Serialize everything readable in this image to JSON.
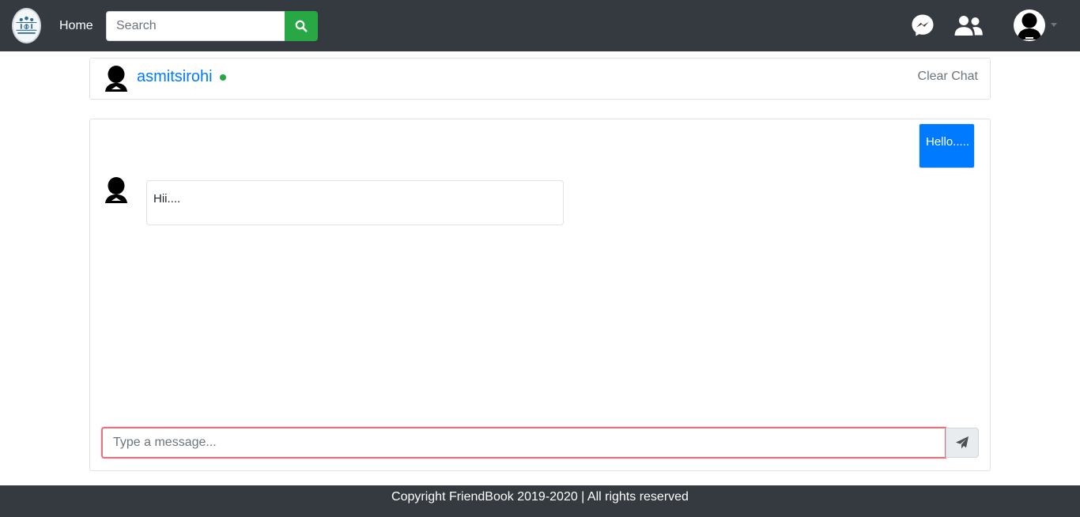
{
  "navbar": {
    "logo_icon": "friendbook-logo-icon",
    "home_label": "Home",
    "search_placeholder": "Search",
    "search_icon": "search-icon",
    "messenger_icon": "messenger-icon",
    "friends_icon": "friends-icon",
    "profile_icon": "user-avatar-icon",
    "search_button_color": "#28a745",
    "background_color": "#343a40"
  },
  "chat_header": {
    "contact_name": "asmitsirohi",
    "status": "online",
    "status_color": "#28a745",
    "clear_label": "Clear Chat"
  },
  "messages": [
    {
      "direction": "outgoing",
      "text": "Hello.....",
      "color": "#007bff"
    },
    {
      "direction": "incoming",
      "text": "Hii...."
    }
  ],
  "composer": {
    "placeholder": "Type a message...",
    "send_icon": "paper-plane-icon"
  },
  "footer": {
    "text": "Copyright FriendBook 2019-2020 | All rights reserved"
  }
}
